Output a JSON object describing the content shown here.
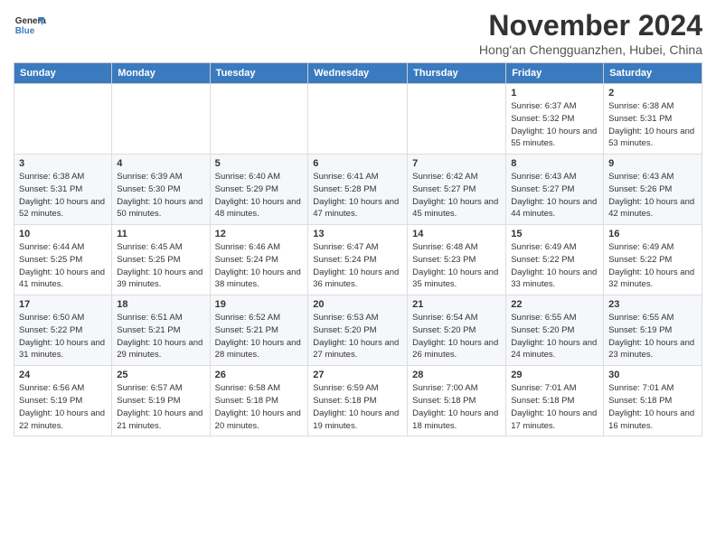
{
  "header": {
    "logo_line1": "General",
    "logo_line2": "Blue",
    "month": "November 2024",
    "location": "Hong'an Chengguanzhen, Hubei, China"
  },
  "weekdays": [
    "Sunday",
    "Monday",
    "Tuesday",
    "Wednesday",
    "Thursday",
    "Friday",
    "Saturday"
  ],
  "weeks": [
    [
      {
        "day": "",
        "info": ""
      },
      {
        "day": "",
        "info": ""
      },
      {
        "day": "",
        "info": ""
      },
      {
        "day": "",
        "info": ""
      },
      {
        "day": "",
        "info": ""
      },
      {
        "day": "1",
        "info": "Sunrise: 6:37 AM\nSunset: 5:32 PM\nDaylight: 10 hours and 55 minutes."
      },
      {
        "day": "2",
        "info": "Sunrise: 6:38 AM\nSunset: 5:31 PM\nDaylight: 10 hours and 53 minutes."
      }
    ],
    [
      {
        "day": "3",
        "info": "Sunrise: 6:38 AM\nSunset: 5:31 PM\nDaylight: 10 hours and 52 minutes."
      },
      {
        "day": "4",
        "info": "Sunrise: 6:39 AM\nSunset: 5:30 PM\nDaylight: 10 hours and 50 minutes."
      },
      {
        "day": "5",
        "info": "Sunrise: 6:40 AM\nSunset: 5:29 PM\nDaylight: 10 hours and 48 minutes."
      },
      {
        "day": "6",
        "info": "Sunrise: 6:41 AM\nSunset: 5:28 PM\nDaylight: 10 hours and 47 minutes."
      },
      {
        "day": "7",
        "info": "Sunrise: 6:42 AM\nSunset: 5:27 PM\nDaylight: 10 hours and 45 minutes."
      },
      {
        "day": "8",
        "info": "Sunrise: 6:43 AM\nSunset: 5:27 PM\nDaylight: 10 hours and 44 minutes."
      },
      {
        "day": "9",
        "info": "Sunrise: 6:43 AM\nSunset: 5:26 PM\nDaylight: 10 hours and 42 minutes."
      }
    ],
    [
      {
        "day": "10",
        "info": "Sunrise: 6:44 AM\nSunset: 5:25 PM\nDaylight: 10 hours and 41 minutes."
      },
      {
        "day": "11",
        "info": "Sunrise: 6:45 AM\nSunset: 5:25 PM\nDaylight: 10 hours and 39 minutes."
      },
      {
        "day": "12",
        "info": "Sunrise: 6:46 AM\nSunset: 5:24 PM\nDaylight: 10 hours and 38 minutes."
      },
      {
        "day": "13",
        "info": "Sunrise: 6:47 AM\nSunset: 5:24 PM\nDaylight: 10 hours and 36 minutes."
      },
      {
        "day": "14",
        "info": "Sunrise: 6:48 AM\nSunset: 5:23 PM\nDaylight: 10 hours and 35 minutes."
      },
      {
        "day": "15",
        "info": "Sunrise: 6:49 AM\nSunset: 5:22 PM\nDaylight: 10 hours and 33 minutes."
      },
      {
        "day": "16",
        "info": "Sunrise: 6:49 AM\nSunset: 5:22 PM\nDaylight: 10 hours and 32 minutes."
      }
    ],
    [
      {
        "day": "17",
        "info": "Sunrise: 6:50 AM\nSunset: 5:22 PM\nDaylight: 10 hours and 31 minutes."
      },
      {
        "day": "18",
        "info": "Sunrise: 6:51 AM\nSunset: 5:21 PM\nDaylight: 10 hours and 29 minutes."
      },
      {
        "day": "19",
        "info": "Sunrise: 6:52 AM\nSunset: 5:21 PM\nDaylight: 10 hours and 28 minutes."
      },
      {
        "day": "20",
        "info": "Sunrise: 6:53 AM\nSunset: 5:20 PM\nDaylight: 10 hours and 27 minutes."
      },
      {
        "day": "21",
        "info": "Sunrise: 6:54 AM\nSunset: 5:20 PM\nDaylight: 10 hours and 26 minutes."
      },
      {
        "day": "22",
        "info": "Sunrise: 6:55 AM\nSunset: 5:20 PM\nDaylight: 10 hours and 24 minutes."
      },
      {
        "day": "23",
        "info": "Sunrise: 6:55 AM\nSunset: 5:19 PM\nDaylight: 10 hours and 23 minutes."
      }
    ],
    [
      {
        "day": "24",
        "info": "Sunrise: 6:56 AM\nSunset: 5:19 PM\nDaylight: 10 hours and 22 minutes."
      },
      {
        "day": "25",
        "info": "Sunrise: 6:57 AM\nSunset: 5:19 PM\nDaylight: 10 hours and 21 minutes."
      },
      {
        "day": "26",
        "info": "Sunrise: 6:58 AM\nSunset: 5:18 PM\nDaylight: 10 hours and 20 minutes."
      },
      {
        "day": "27",
        "info": "Sunrise: 6:59 AM\nSunset: 5:18 PM\nDaylight: 10 hours and 19 minutes."
      },
      {
        "day": "28",
        "info": "Sunrise: 7:00 AM\nSunset: 5:18 PM\nDaylight: 10 hours and 18 minutes."
      },
      {
        "day": "29",
        "info": "Sunrise: 7:01 AM\nSunset: 5:18 PM\nDaylight: 10 hours and 17 minutes."
      },
      {
        "day": "30",
        "info": "Sunrise: 7:01 AM\nSunset: 5:18 PM\nDaylight: 10 hours and 16 minutes."
      }
    ]
  ]
}
